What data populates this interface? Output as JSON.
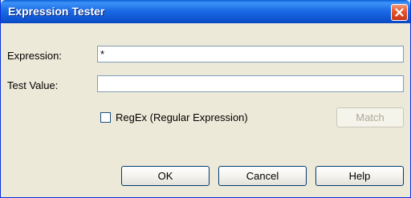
{
  "window": {
    "title": "Expression Tester",
    "close_icon": "close-icon"
  },
  "form": {
    "expression_label": "Expression:",
    "expression_value": "*",
    "test_value_label": "Test Value:",
    "test_value_value": "",
    "regex_label": "RegEx (Regular Expression)",
    "regex_checked": false
  },
  "buttons": {
    "match": "Match",
    "ok": "OK",
    "cancel": "Cancel",
    "help": "Help"
  },
  "colors": {
    "title_bar": "#0f56d3",
    "close_button": "#e2552d",
    "dialog_background": "#ece9d8"
  }
}
